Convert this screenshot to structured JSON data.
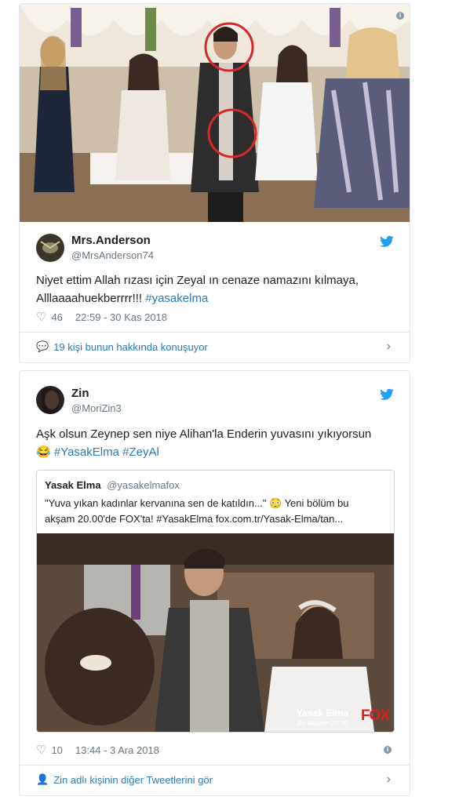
{
  "tweet1": {
    "name": "Mrs.Anderson",
    "handle": "@MrsAnderson74",
    "text": "Niyet ettim Allah rızası için Zeyal ın cenaze namazını kılmaya,",
    "text2": "Alllaaaahuekberrrr!!!",
    "hashtag": "#yasakelma",
    "likes": "46",
    "timestamp": "22:59 - 30 Kas 2018",
    "conversation": "19 kişi bunun hakkında konuşuyor"
  },
  "tweet2": {
    "name": "Zin",
    "handle": "@MoriZin3",
    "text": "Aşk olsun Zeynep sen niye Alihan'la Enderin yuvasını yıkıyorsun",
    "emoji": "😂",
    "hashtags": "#YasakElma #ZeyAl",
    "likes": "10",
    "timestamp": "13:44 - 3 Ara 2018",
    "more_tweets": "Zin adlı kişinin diğer Tweetlerini gör",
    "quote": {
      "name": "Yasak Elma",
      "handle": "@yasakelmafox",
      "line1": "\"Yuva yıkan kadınlar kervanına sen de katıldın...\" 😳 Yeni bölüm bu",
      "line2": "akşam 20.00'de FOX'ta! #YasakElma fox.com.tr/Yasak-Elma/tan...",
      "overlay_title": "Yasak Elma",
      "overlay_sub": "Bu Akşam 20.00",
      "overlay_logo": "FOX"
    }
  },
  "colors": {
    "link": "#2b7bb9",
    "muted": "#697882",
    "border": "#e1e8ed",
    "twitter": "#1da1f2"
  }
}
